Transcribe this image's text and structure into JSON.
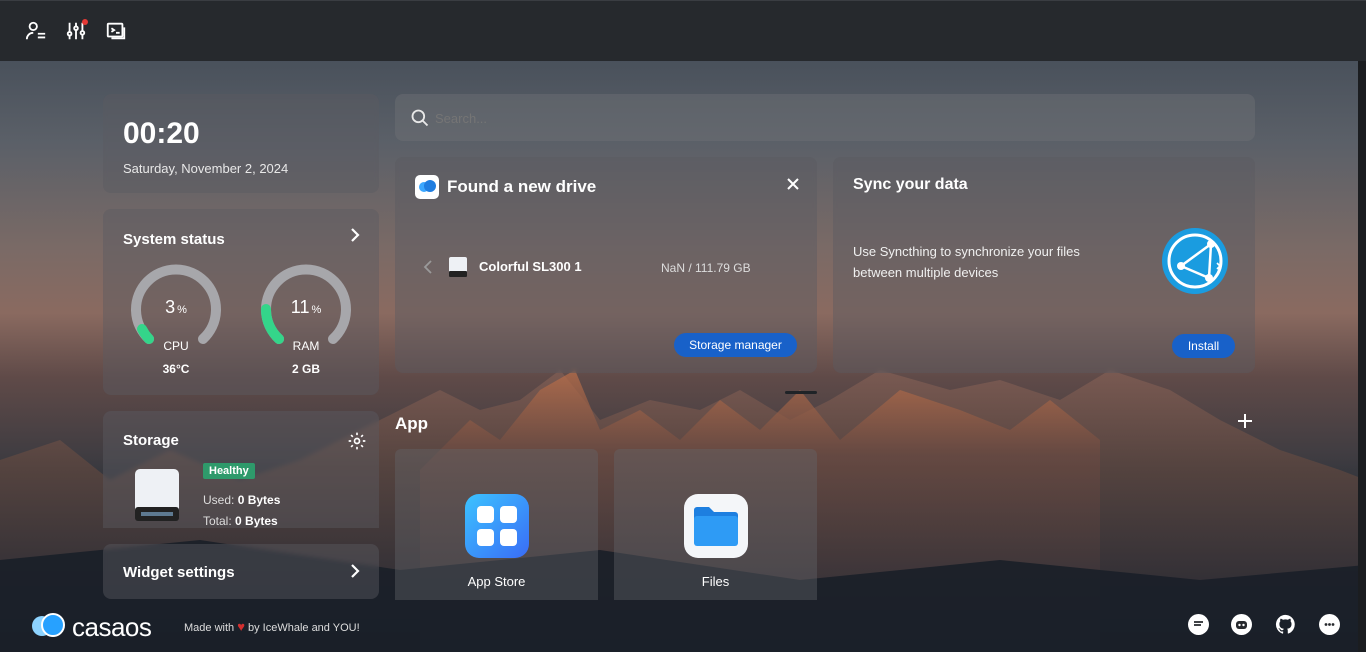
{
  "topbar": {
    "icons": [
      "user-settings-icon",
      "sliders-icon",
      "terminal-icon"
    ]
  },
  "clock": {
    "time": "00:20",
    "date": "Saturday, November 2, 2024"
  },
  "system_status": {
    "title": "System status",
    "cpu": {
      "value": "3",
      "unit": "%",
      "label": "CPU",
      "sub": "36°C",
      "fraction": 0.03
    },
    "ram": {
      "value": "11",
      "unit": "%",
      "label": "RAM",
      "sub": "2 GB",
      "fraction": 0.11
    }
  },
  "storage": {
    "title": "Storage",
    "status": "Healthy",
    "used_label": "Used:",
    "used_value": "0 Bytes",
    "total_label": "Total:",
    "total_value": "0 Bytes"
  },
  "widget_settings": {
    "label": "Widget settings"
  },
  "search": {
    "placeholder": "Search..."
  },
  "new_drive": {
    "title": "Found a new drive",
    "drive_name": "Colorful SL300 1",
    "drive_size": "NaN / 111.79 GB",
    "button": "Storage manager"
  },
  "sync": {
    "title": "Sync your data",
    "description": "Use Syncthing to synchronize your files between multiple devices",
    "button": "Install"
  },
  "apps": {
    "title": "App",
    "items": [
      {
        "label": "App Store",
        "icon": "app-store-icon"
      },
      {
        "label": "Files",
        "icon": "folder-icon"
      }
    ]
  },
  "footer": {
    "logo": "casaos",
    "made_with": "Made with",
    "by": "by IceWhale and YOU!",
    "icons": [
      "feedback-icon",
      "discord-icon",
      "github-icon",
      "chat-icon"
    ]
  },
  "colors": {
    "accent": "#1861c9",
    "healthy": "#2e9a6b",
    "gauge": "#34d58a"
  }
}
